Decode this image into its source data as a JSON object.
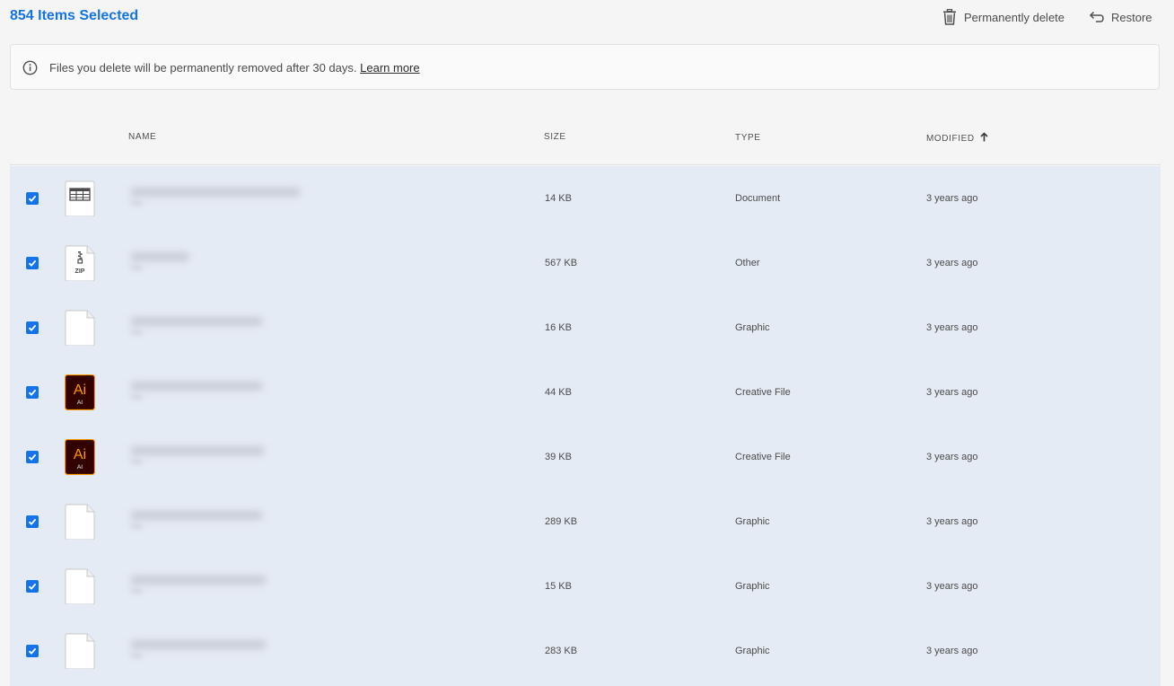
{
  "header": {
    "selected_label": "854 Items Selected",
    "delete_label": "Permanently delete",
    "restore_label": "Restore"
  },
  "banner": {
    "message": "Files you delete will be permanently removed after 30 days.",
    "link": "Learn more"
  },
  "table": {
    "columns": {
      "name": "NAME",
      "size": "SIZE",
      "type": "TYPE",
      "modified": "MODIFIED"
    },
    "sort": "modified-ascending",
    "rows": [
      {
        "icon": "spreadsheet-file-icon",
        "checked": true,
        "size": "14 KB",
        "type": "Document",
        "modified": "3 years ago"
      },
      {
        "icon": "zip-file-icon",
        "checked": true,
        "size": "567 KB",
        "type": "Other",
        "modified": "3 years ago"
      },
      {
        "icon": "blank-file-icon",
        "checked": true,
        "size": "16 KB",
        "type": "Graphic",
        "modified": "3 years ago"
      },
      {
        "icon": "illustrator-file-icon",
        "checked": true,
        "size": "44 KB",
        "type": "Creative File",
        "modified": "3 years ago"
      },
      {
        "icon": "illustrator-file-icon",
        "checked": true,
        "size": "39 KB",
        "type": "Creative File",
        "modified": "3 years ago"
      },
      {
        "icon": "blank-file-icon",
        "checked": true,
        "size": "289 KB",
        "type": "Graphic",
        "modified": "3 years ago"
      },
      {
        "icon": "blank-file-icon",
        "checked": true,
        "size": "15 KB",
        "type": "Graphic",
        "modified": "3 years ago"
      },
      {
        "icon": "blank-file-icon",
        "checked": true,
        "size": "283 KB",
        "type": "Graphic",
        "modified": "3 years ago"
      }
    ]
  },
  "icons": {
    "zip_label": "ZIP",
    "ai_label": "Ai",
    "ai_sub": "AI"
  },
  "colors": {
    "accent": "#1473e6",
    "selected_row": "#e5ebf4",
    "ai_bg": "#330000",
    "ai_fg": "#ff9a00"
  }
}
